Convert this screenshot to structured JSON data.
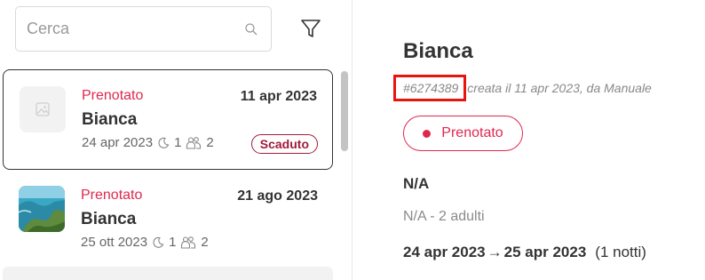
{
  "search": {
    "placeholder": "Cerca"
  },
  "bookings": [
    {
      "status": "Prenotato",
      "created": "11 apr 2023",
      "name": "Bianca",
      "checkin": "24 apr 2023",
      "nights": "1",
      "guests": "2",
      "badge": "Scaduto"
    },
    {
      "status": "Prenotato",
      "created": "21 ago 2023",
      "name": "Bianca",
      "checkin": "25 ott 2023",
      "nights": "1",
      "guests": "2"
    }
  ],
  "detail": {
    "title": "Bianca",
    "reference": "#6274389",
    "created_text": "creata il 11 apr 2023, da Manuale",
    "status": "Prenotato",
    "section_title": "N/A",
    "section_sub": "N/A - 2 adulti",
    "date_from": "24 apr 2023",
    "date_to": "25 apr 2023",
    "nights_text": "(1 notti)"
  },
  "colors": {
    "accent": "#e0284f",
    "badge": "#a01b3c",
    "highlight": "#e8150f"
  }
}
